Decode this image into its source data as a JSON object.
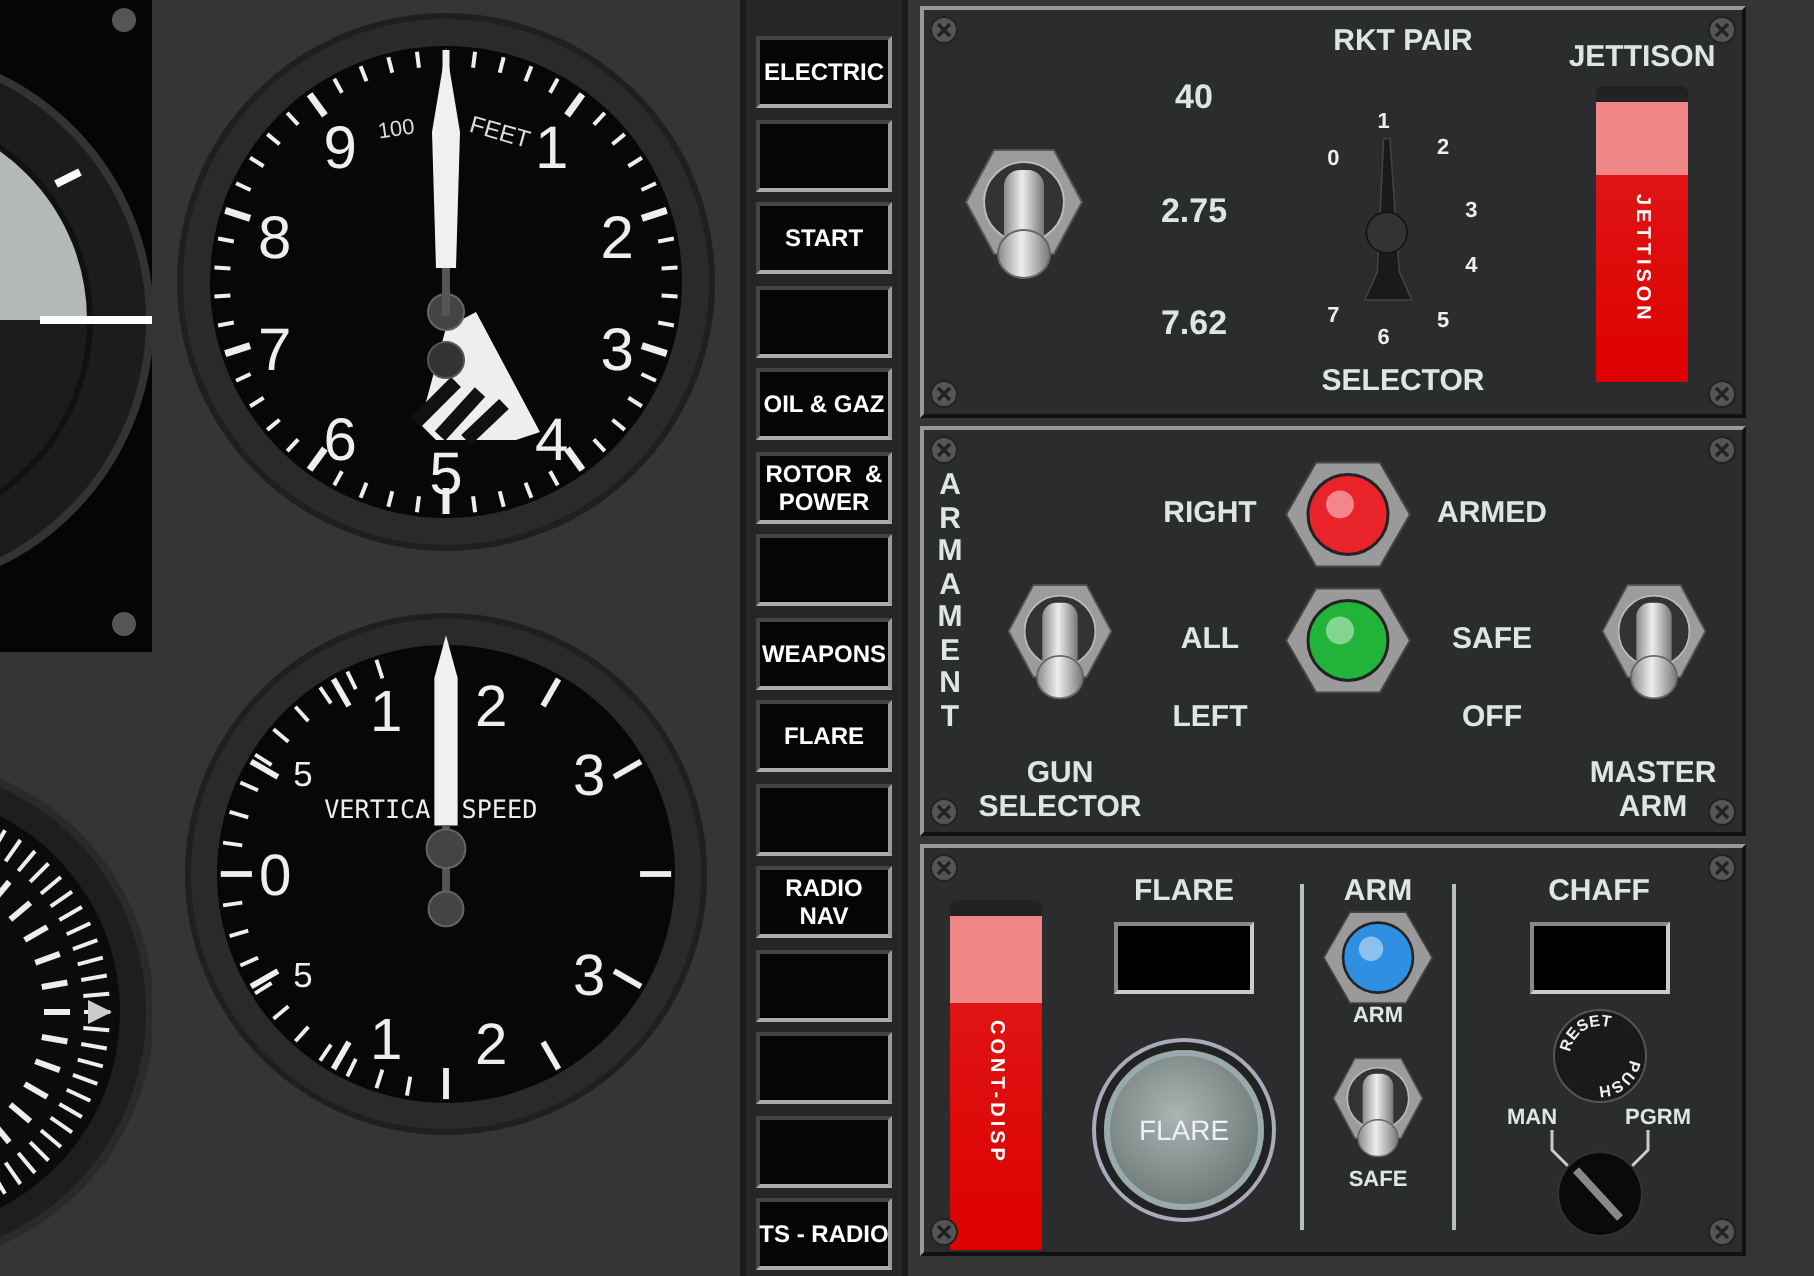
{
  "altimeter": {
    "scale": "100",
    "unit": "FEET",
    "numerals": [
      "1",
      "2",
      "3",
      "4",
      "5",
      "6",
      "7",
      "8",
      "9"
    ]
  },
  "vertical_speed": {
    "label_left": "VERTICA",
    "label_right": "SPEED",
    "numerals": [
      "0",
      "5",
      "1",
      "2",
      "3",
      "5",
      "1",
      "2",
      "3"
    ]
  },
  "system_buttons": [
    {
      "kind": "labeled",
      "lines": [
        "ELECTRIC"
      ]
    },
    {
      "kind": "blank"
    },
    {
      "kind": "labeled",
      "lines": [
        "START"
      ]
    },
    {
      "kind": "blank"
    },
    {
      "kind": "labeled",
      "lines": [
        "OIL & GAZ"
      ]
    },
    {
      "kind": "labeled",
      "lines": [
        "ROTOR  &",
        "POWER"
      ]
    },
    {
      "kind": "blank"
    },
    {
      "kind": "labeled",
      "lines": [
        "WEAPONS"
      ]
    },
    {
      "kind": "labeled",
      "lines": [
        "FLARE"
      ]
    },
    {
      "kind": "blank"
    },
    {
      "kind": "labeled",
      "lines": [
        "RADIO",
        "NAV"
      ]
    },
    {
      "kind": "blank"
    },
    {
      "kind": "blank"
    },
    {
      "kind": "blank"
    },
    {
      "kind": "labeled",
      "lines": [
        "TS - RADIO"
      ]
    }
  ],
  "rocket_panel": {
    "switch": {
      "on": false
    },
    "switch_values": [
      "40",
      "2.75",
      "7.62"
    ],
    "selector": {
      "title": "RKT PAIR",
      "positions": [
        "1",
        "0",
        "2",
        "3",
        "4",
        "7",
        "5",
        "6"
      ],
      "label": "SELECTOR"
    },
    "jettison": {
      "title": "JETTISON",
      "guard_label": "JETTISON",
      "open": false
    }
  },
  "armament_panel": {
    "title": "ARMAMENT",
    "gun_selector": {
      "on": false,
      "positions": [
        "RIGHT",
        "ALL",
        "LEFT"
      ],
      "label": [
        "GUN",
        "SELECTOR"
      ]
    },
    "lights": [
      {
        "color": "#e8232a"
      },
      {
        "color": "#22b33a"
      }
    ],
    "master_arm": {
      "on": false,
      "positions": [
        "ARMED",
        "SAFE",
        "OFF"
      ],
      "label": [
        "MASTER",
        "ARM"
      ]
    }
  },
  "countermeasures_panel": {
    "cont_disp": {
      "label": "CONT-DISP",
      "open": false
    },
    "flare": {
      "title": "FLARE",
      "button": "FLARE"
    },
    "arm": {
      "title": "ARM",
      "light": {
        "color": "#2f8fe0"
      },
      "light_label": "ARM",
      "switch": {
        "on": false
      },
      "switch_label": "SAFE"
    },
    "chaff": {
      "title": "CHAFF",
      "knob_labels": [
        "RESET",
        "PUSH"
      ],
      "modes": [
        "MAN",
        "PGRM"
      ]
    }
  }
}
